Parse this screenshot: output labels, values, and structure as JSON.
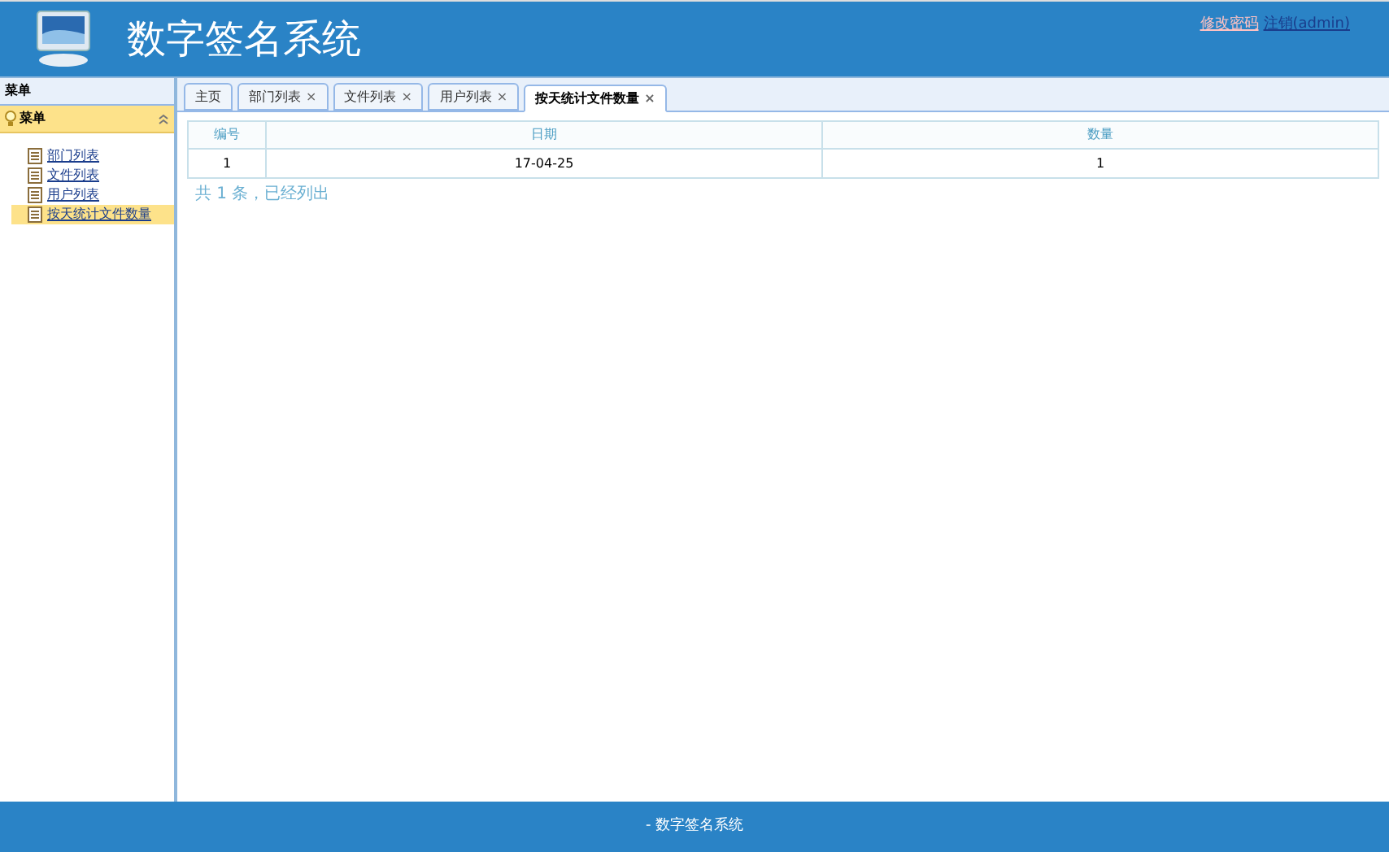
{
  "header": {
    "title": "数字签名系统",
    "links": [
      "修改密码",
      "注销(admin)"
    ]
  },
  "sidebar": {
    "title": "菜单",
    "panel": {
      "title": "菜单",
      "expanded": true
    },
    "items": [
      {
        "label": "部门列表",
        "selected": false
      },
      {
        "label": "文件列表",
        "selected": false
      },
      {
        "label": "用户列表",
        "selected": false
      },
      {
        "label": "按天统计文件数量",
        "selected": true
      }
    ]
  },
  "tabs": [
    {
      "label": "主页",
      "selected": false,
      "closable": false
    },
    {
      "label": "部门列表",
      "selected": false,
      "closable": true
    },
    {
      "label": "文件列表",
      "selected": false,
      "closable": true
    },
    {
      "label": "用户列表",
      "selected": false,
      "closable": true
    },
    {
      "label": "按天统计文件数量",
      "selected": true,
      "closable": true
    }
  ],
  "close_glyph": "×",
  "table": {
    "columns": [
      "编号",
      "日期",
      "数量"
    ],
    "rows": [
      [
        "1",
        "17-04-25",
        "1"
      ]
    ]
  },
  "summary": "共 1 条，已经列出",
  "footer": "- 数字签名系统"
}
